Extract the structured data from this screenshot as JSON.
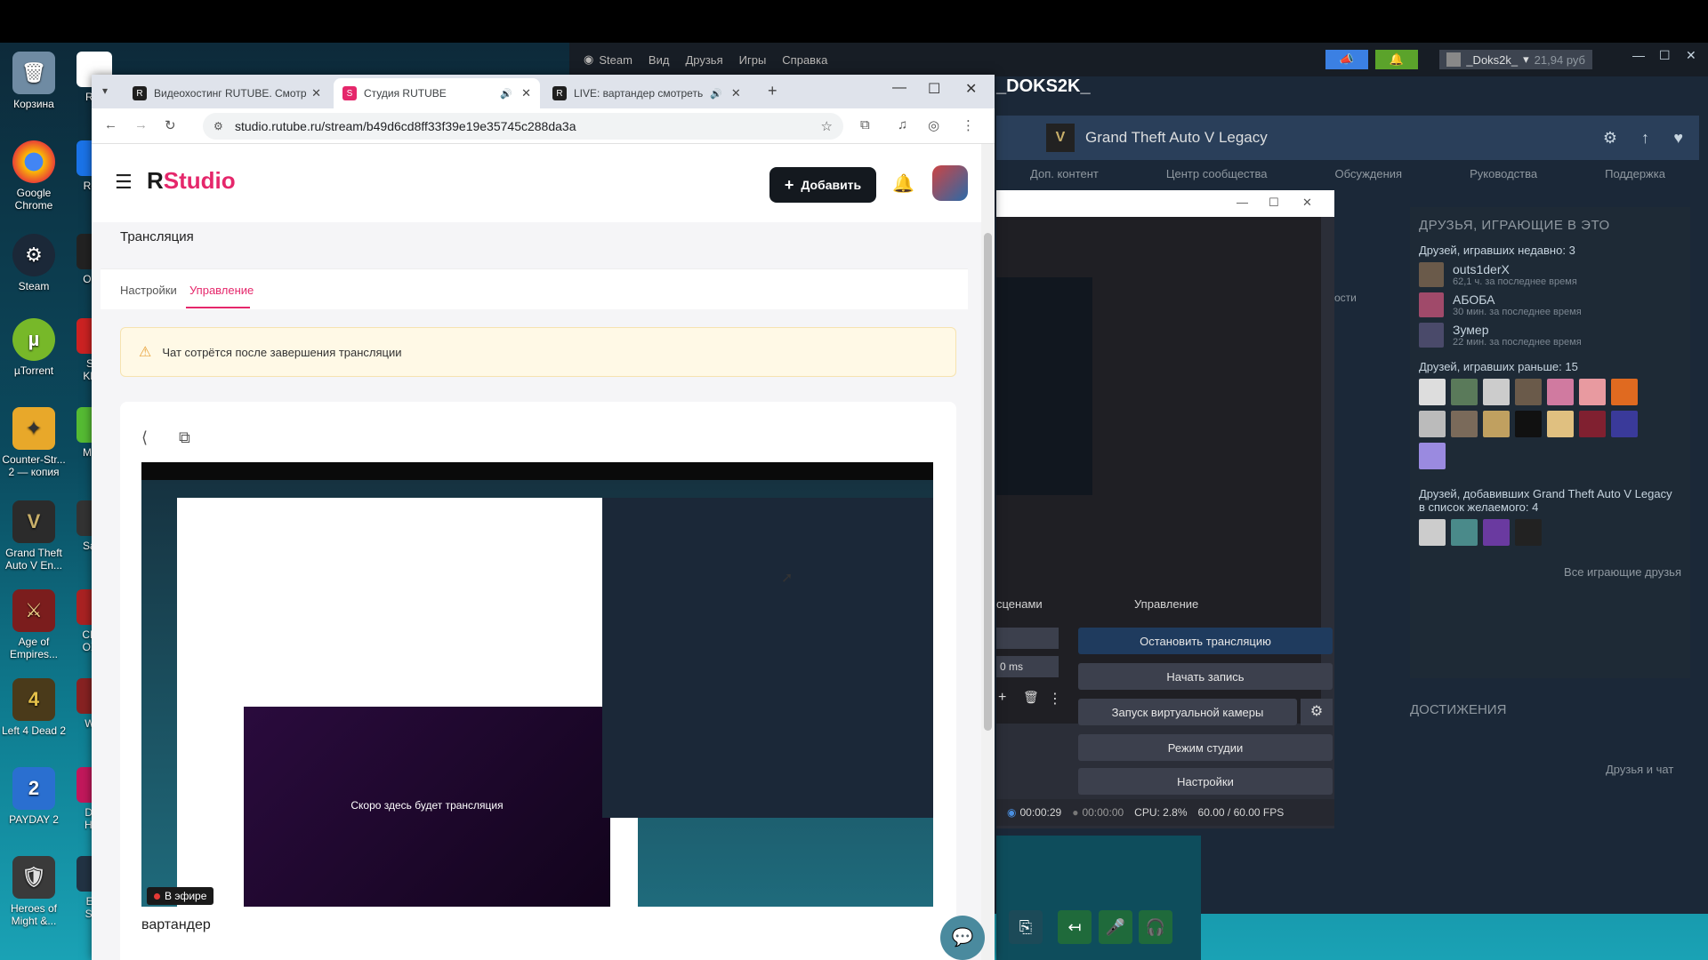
{
  "desktop": {
    "icons": [
      {
        "label": "Корзина"
      },
      {
        "label": "Google Chrome"
      },
      {
        "label": "Steam"
      },
      {
        "label": "µTorrent"
      },
      {
        "label": "Counter-Str... 2 — копия"
      },
      {
        "label": "Grand Theft Auto V En..."
      },
      {
        "label": "Age of Empires..."
      },
      {
        "label": "Left 4 Dead 2"
      },
      {
        "label": "PAYDAY 2"
      },
      {
        "label": "Heroes of Might &..."
      }
    ],
    "icons2": [
      {
        "label": "R S"
      },
      {
        "label": "Robl"
      },
      {
        "label": "OnTi"
      },
      {
        "label": "Ste Khar"
      },
      {
        "label": "M Cr"
      },
      {
        "label": "Sa V"
      },
      {
        "label": "CИM OXO"
      },
      {
        "label": "War"
      },
      {
        "label": "Driv Hori"
      },
      {
        "label": "Eur Sim"
      }
    ]
  },
  "steam": {
    "menu": [
      "Steam",
      "Вид",
      "Друзья",
      "Игры",
      "Справка"
    ],
    "user": "_Doks2k_",
    "balance": "21,94 руб",
    "page_title": "_DOKS2K_",
    "game_name": "Grand Theft Auto V Legacy",
    "game_tabs": [
      "Доп. контент",
      "Центр сообщества",
      "Обсуждения",
      "Руководства",
      "Поддержка"
    ],
    "friends_header": "ДРУЗЬЯ, ИГРАЮЩИЕ В ЭТО",
    "recent_label": "Друзей, игравших недавно: 3",
    "recent": [
      {
        "name": "outs1derX",
        "time": "62,1 ч. за последнее время"
      },
      {
        "name": "АБОБА",
        "time": "30 мин. за последнее время"
      },
      {
        "name": "Зумер",
        "time": "22 мин. за последнее время"
      }
    ],
    "earlier_label": "Друзей, игравших раньше: 15",
    "wishlist_label": "Друзей, добавивших Grand Theft Auto V Legacy в список желаемого: 4",
    "all_friends_link": "Все играющие друзья",
    "achievements": "ДОСТИЖЕНИЯ",
    "friends_chat": "Друзья и чат",
    "side_text": "ости"
  },
  "obs": {
    "scenes_label": "сценами",
    "controls_label": "Управление",
    "buttons": {
      "stop_stream": "Остановить трансляцию",
      "start_record": "Начать запись",
      "virtual_cam": "Запуск виртуальной камеры",
      "studio_mode": "Режим студии",
      "settings": "Настройки"
    },
    "delay_value": "0 ms",
    "status": {
      "stream_time": "00:00:29",
      "record_time": "00:00:00",
      "cpu": "CPU: 2.8%",
      "fps": "60.00 / 60.00 FPS"
    }
  },
  "chrome": {
    "tabs": [
      {
        "title": "Видеохостинг RUTUBE. Смотр",
        "active": false
      },
      {
        "title": "Студия RUTUBE",
        "active": true
      },
      {
        "title": "LIVE: вартандер смотреть",
        "active": false
      }
    ],
    "url": "studio.rutube.ru/stream/b49d6cd8ff33f39e19e35745c288da3a"
  },
  "studio": {
    "logo_r": "R",
    "logo_text": "Studio",
    "add_button": "Добавить",
    "section_title": "Трансляция",
    "tabs": {
      "settings": "Настройки",
      "manage": "Управление"
    },
    "alert_text": "Чат сотрётся после завершения трансляции",
    "player_placeholder": "Скоро здесь будет трансляция",
    "live_badge": "В эфире",
    "stream_title": "вартандер"
  },
  "colors": {
    "accent": "#e5276b",
    "steam_bg": "#1b2838",
    "obs_active": "#1f3b5e"
  }
}
